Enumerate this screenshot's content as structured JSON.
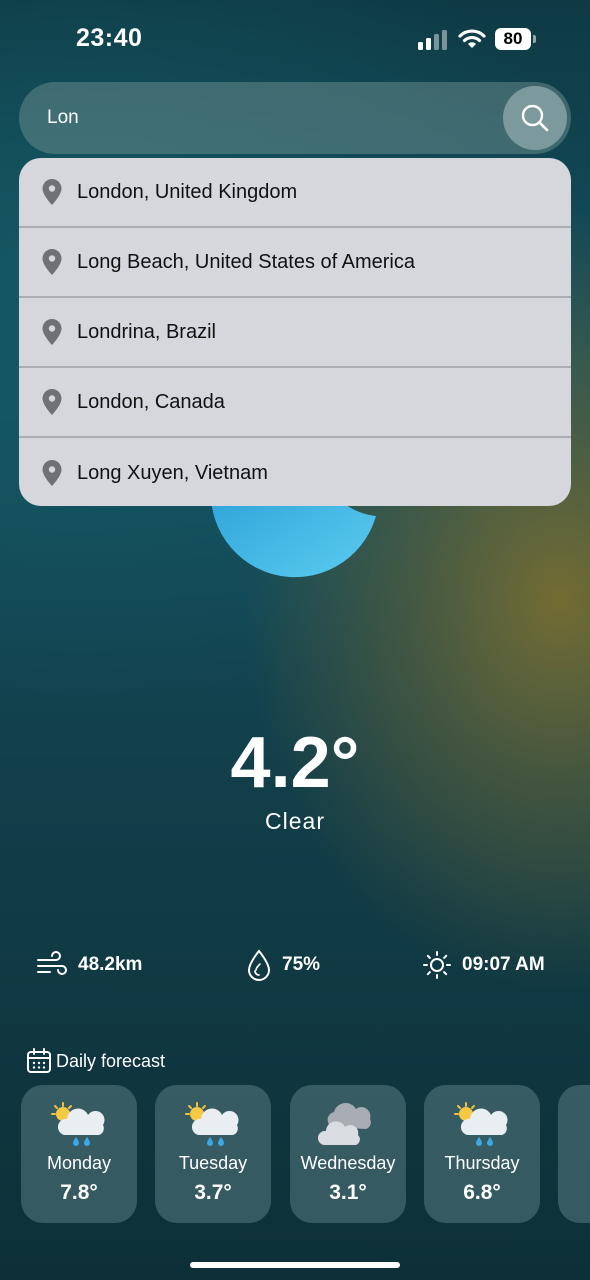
{
  "status_bar": {
    "time": "23:40",
    "battery": "80"
  },
  "search": {
    "value": "Lon",
    "placeholder": ""
  },
  "suggestions": [
    {
      "label": "London, United Kingdom"
    },
    {
      "label": "Long Beach, United States of America"
    },
    {
      "label": "Londrina, Brazil"
    },
    {
      "label": "London, Canada"
    },
    {
      "label": "Long Xuyen, Vietnam"
    }
  ],
  "weather": {
    "temperature": "4.2°",
    "condition": "Clear",
    "icon": "crescent-moon-icon",
    "wind": "48.2km",
    "humidity": "75%",
    "sunrise": "09:07 AM"
  },
  "daily": {
    "title": "Daily forecast",
    "days": [
      {
        "day": "Monday",
        "temp": "7.8°",
        "icon": "sun-cloud-rain-icon"
      },
      {
        "day": "Tuesday",
        "temp": "3.7°",
        "icon": "sun-cloud-rain-icon"
      },
      {
        "day": "Wednesday",
        "temp": "3.1°",
        "icon": "cloudy-icon"
      },
      {
        "day": "Thursday",
        "temp": "6.8°",
        "icon": "sun-cloud-rain-icon"
      }
    ]
  },
  "colors": {
    "accent_blue": "#4fc3ef",
    "dropdown_bg": "#d5d7dd"
  }
}
